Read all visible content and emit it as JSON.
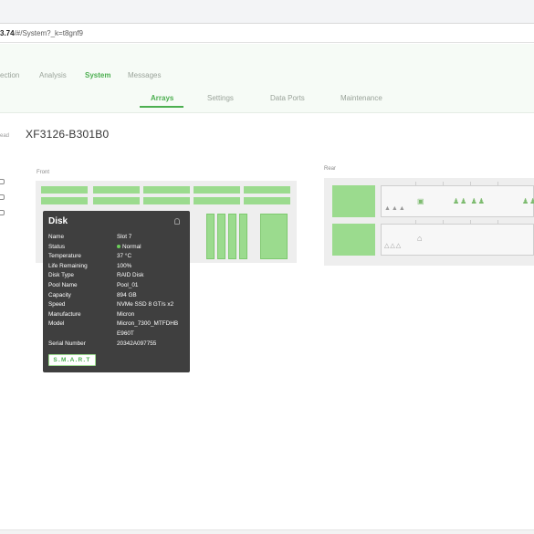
{
  "browser": {
    "url_host": "3.74",
    "url_path": "/#/System?_k=t8gnf9"
  },
  "main_nav": {
    "items": [
      {
        "label": "ection",
        "active": false
      },
      {
        "label": "Analysis",
        "active": false
      },
      {
        "label": "System",
        "active": true
      },
      {
        "label": "Messages",
        "active": false
      }
    ]
  },
  "sub_nav": {
    "tabs": [
      {
        "label": "Arrays",
        "active": true
      },
      {
        "label": "Settings",
        "active": false
      },
      {
        "label": "Data Ports",
        "active": false
      },
      {
        "label": "Maintenance",
        "active": false
      }
    ]
  },
  "sidebar": {
    "label": "ead"
  },
  "device": {
    "name": "XF3126-B301B0"
  },
  "panels": {
    "front_label": "Front",
    "rear_label": "Rear"
  },
  "tooltip": {
    "title": "Disk",
    "name": {
      "key": "Name",
      "value": "Slot 7"
    },
    "status": {
      "key": "Status",
      "value": "Normal"
    },
    "temperature": {
      "key": "Temperature",
      "value": "37 °C"
    },
    "life": {
      "key": "Life Remaining",
      "value": "100%"
    },
    "disk_type": {
      "key": "Disk Type",
      "value": "RAID Disk"
    },
    "pool": {
      "key": "Pool Name",
      "value": "Pool_01"
    },
    "capacity": {
      "key": "Capacity",
      "value": "894 GB"
    },
    "speed": {
      "key": "Speed",
      "value": "NVMe SSD 8 GT/s x2"
    },
    "manufacture": {
      "key": "Manufacture",
      "value": "Micron"
    },
    "model": {
      "key": "Model",
      "value": "Micron_7300_MTFDHB",
      "value2": "E960T"
    },
    "serial": {
      "key": "Serial Number",
      "value": "20342A097755"
    },
    "smart_button": "S.M.A.R.T"
  },
  "rear": {
    "bay1_ports": "▲▲▲",
    "bay1_link": "▣",
    "bay1_group2": "♟♟ ♟♟",
    "bay1_group3": "♟♟",
    "bay2_ports": "△△△"
  },
  "colors": {
    "accent": "#4caf50",
    "slot_fill": "#9bdb8e",
    "tooltip_bg": "#3f3f3f"
  }
}
